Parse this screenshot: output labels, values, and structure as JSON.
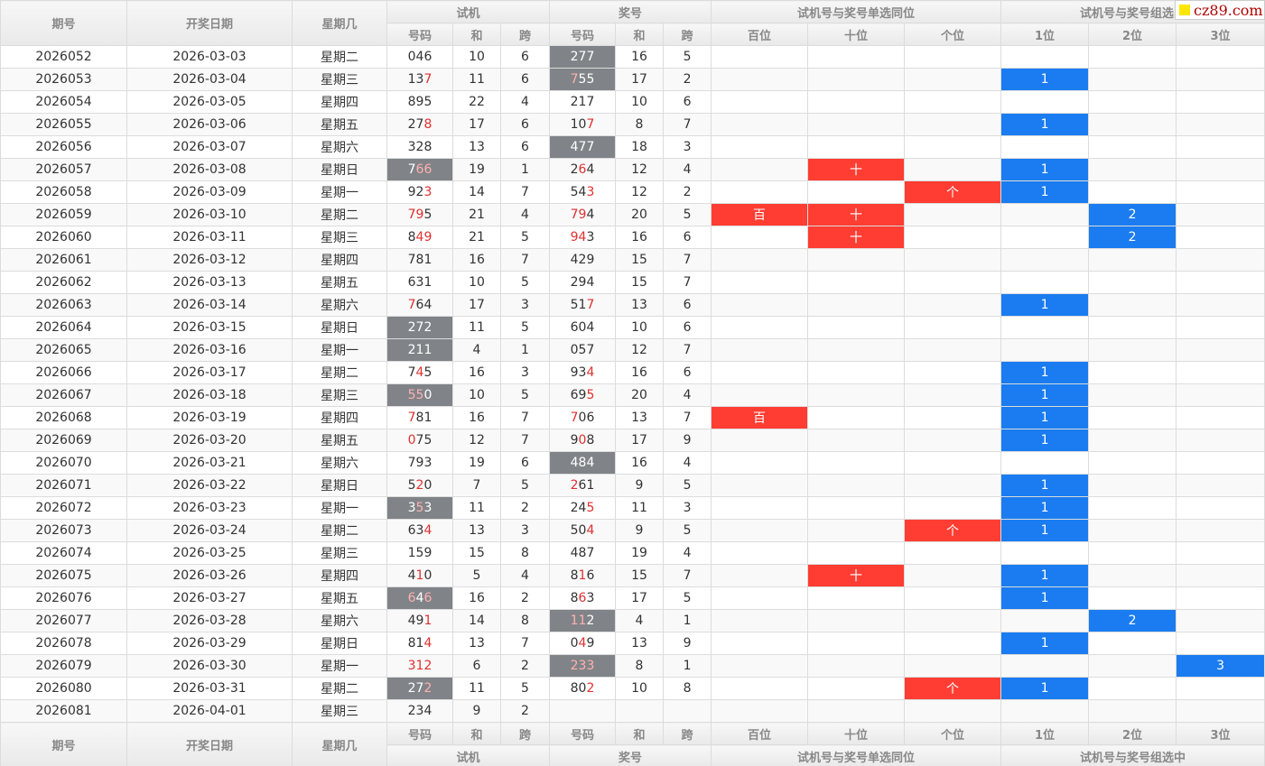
{
  "header": {
    "period": "期号",
    "date": "开奖日期",
    "weekday": "星期几",
    "test_group": "试机",
    "prize_group": "奖号",
    "single_group": "试机号与奖号单选同位",
    "combo_group": "试机号与奖号组选中",
    "num": "号码",
    "sum": "和",
    "span": "跨",
    "hundreds": "百位",
    "tens": "十位",
    "units": "个位",
    "pos1": "1位",
    "pos2": "2位",
    "pos3": "3位"
  },
  "watermark": "cz89.com",
  "colors": {
    "red_cell": "#ff3d33",
    "blue_cell": "#1a7cf0",
    "gray_cell": "#808488",
    "red_digit": "#e03030"
  },
  "rows": [
    {
      "period": "2026052",
      "date": "2026-03-03",
      "weekday": "星期二",
      "test": "046",
      "test_sum": "10",
      "test_span": "6",
      "prize": "277",
      "prize_sum": "16",
      "prize_span": "5",
      "test_gray": false,
      "prize_gray": true,
      "test_red": [],
      "prize_red": [],
      "bai": "",
      "shi": "",
      "ge": "",
      "c1": "",
      "c2": "",
      "c3": ""
    },
    {
      "period": "2026053",
      "date": "2026-03-04",
      "weekday": "星期三",
      "test": "137",
      "test_sum": "11",
      "test_span": "6",
      "prize": "755",
      "prize_sum": "17",
      "prize_span": "2",
      "test_gray": false,
      "prize_gray": true,
      "test_red": [
        2
      ],
      "prize_red": [
        0
      ],
      "bai": "",
      "shi": "",
      "ge": "",
      "c1": "1",
      "c2": "",
      "c3": ""
    },
    {
      "period": "2026054",
      "date": "2026-03-05",
      "weekday": "星期四",
      "test": "895",
      "test_sum": "22",
      "test_span": "4",
      "prize": "217",
      "prize_sum": "10",
      "prize_span": "6",
      "test_gray": false,
      "prize_gray": false,
      "test_red": [],
      "prize_red": [],
      "bai": "",
      "shi": "",
      "ge": "",
      "c1": "",
      "c2": "",
      "c3": ""
    },
    {
      "period": "2026055",
      "date": "2026-03-06",
      "weekday": "星期五",
      "test": "278",
      "test_sum": "17",
      "test_span": "6",
      "prize": "107",
      "prize_sum": "8",
      "prize_span": "7",
      "test_gray": false,
      "prize_gray": false,
      "test_red": [
        2
      ],
      "prize_red": [
        2
      ],
      "bai": "",
      "shi": "",
      "ge": "",
      "c1": "1",
      "c2": "",
      "c3": ""
    },
    {
      "period": "2026056",
      "date": "2026-03-07",
      "weekday": "星期六",
      "test": "328",
      "test_sum": "13",
      "test_span": "6",
      "prize": "477",
      "prize_sum": "18",
      "prize_span": "3",
      "test_gray": false,
      "prize_gray": true,
      "test_red": [],
      "prize_red": [],
      "bai": "",
      "shi": "",
      "ge": "",
      "c1": "",
      "c2": "",
      "c3": ""
    },
    {
      "period": "2026057",
      "date": "2026-03-08",
      "weekday": "星期日",
      "test": "766",
      "test_sum": "19",
      "test_span": "1",
      "prize": "264",
      "prize_sum": "12",
      "prize_span": "4",
      "test_gray": true,
      "prize_gray": false,
      "test_red": [
        1,
        2
      ],
      "prize_red": [
        1
      ],
      "bai": "",
      "shi": "十",
      "ge": "",
      "c1": "1",
      "c2": "",
      "c3": ""
    },
    {
      "period": "2026058",
      "date": "2026-03-09",
      "weekday": "星期一",
      "test": "923",
      "test_sum": "14",
      "test_span": "7",
      "prize": "543",
      "prize_sum": "12",
      "prize_span": "2",
      "test_gray": false,
      "prize_gray": false,
      "test_red": [
        2
      ],
      "prize_red": [
        2
      ],
      "bai": "",
      "shi": "",
      "ge": "个",
      "c1": "1",
      "c2": "",
      "c3": ""
    },
    {
      "period": "2026059",
      "date": "2026-03-10",
      "weekday": "星期二",
      "test": "795",
      "test_sum": "21",
      "test_span": "4",
      "prize": "794",
      "prize_sum": "20",
      "prize_span": "5",
      "test_gray": false,
      "prize_gray": false,
      "test_red": [
        0,
        1
      ],
      "prize_red": [
        0,
        1
      ],
      "bai": "百",
      "shi": "十",
      "ge": "",
      "c1": "",
      "c2": "2",
      "c3": ""
    },
    {
      "period": "2026060",
      "date": "2026-03-11",
      "weekday": "星期三",
      "test": "849",
      "test_sum": "21",
      "test_span": "5",
      "prize": "943",
      "prize_sum": "16",
      "prize_span": "6",
      "test_gray": false,
      "prize_gray": false,
      "test_red": [
        1,
        2
      ],
      "prize_red": [
        0,
        1
      ],
      "bai": "",
      "shi": "十",
      "ge": "",
      "c1": "",
      "c2": "2",
      "c3": ""
    },
    {
      "period": "2026061",
      "date": "2026-03-12",
      "weekday": "星期四",
      "test": "781",
      "test_sum": "16",
      "test_span": "7",
      "prize": "429",
      "prize_sum": "15",
      "prize_span": "7",
      "test_gray": false,
      "prize_gray": false,
      "test_red": [],
      "prize_red": [],
      "bai": "",
      "shi": "",
      "ge": "",
      "c1": "",
      "c2": "",
      "c3": ""
    },
    {
      "period": "2026062",
      "date": "2026-03-13",
      "weekday": "星期五",
      "test": "631",
      "test_sum": "10",
      "test_span": "5",
      "prize": "294",
      "prize_sum": "15",
      "prize_span": "7",
      "test_gray": false,
      "prize_gray": false,
      "test_red": [],
      "prize_red": [],
      "bai": "",
      "shi": "",
      "ge": "",
      "c1": "",
      "c2": "",
      "c3": ""
    },
    {
      "period": "2026063",
      "date": "2026-03-14",
      "weekday": "星期六",
      "test": "764",
      "test_sum": "17",
      "test_span": "3",
      "prize": "517",
      "prize_sum": "13",
      "prize_span": "6",
      "test_gray": false,
      "prize_gray": false,
      "test_red": [
        0
      ],
      "prize_red": [
        2
      ],
      "bai": "",
      "shi": "",
      "ge": "",
      "c1": "1",
      "c2": "",
      "c3": ""
    },
    {
      "period": "2026064",
      "date": "2026-03-15",
      "weekday": "星期日",
      "test": "272",
      "test_sum": "11",
      "test_span": "5",
      "prize": "604",
      "prize_sum": "10",
      "prize_span": "6",
      "test_gray": true,
      "prize_gray": false,
      "test_red": [],
      "prize_red": [],
      "bai": "",
      "shi": "",
      "ge": "",
      "c1": "",
      "c2": "",
      "c3": ""
    },
    {
      "period": "2026065",
      "date": "2026-03-16",
      "weekday": "星期一",
      "test": "211",
      "test_sum": "4",
      "test_span": "1",
      "prize": "057",
      "prize_sum": "12",
      "prize_span": "7",
      "test_gray": true,
      "prize_gray": false,
      "test_red": [],
      "prize_red": [],
      "bai": "",
      "shi": "",
      "ge": "",
      "c1": "",
      "c2": "",
      "c3": ""
    },
    {
      "period": "2026066",
      "date": "2026-03-17",
      "weekday": "星期二",
      "test": "745",
      "test_sum": "16",
      "test_span": "3",
      "prize": "934",
      "prize_sum": "16",
      "prize_span": "6",
      "test_gray": false,
      "prize_gray": false,
      "test_red": [
        1
      ],
      "prize_red": [
        2
      ],
      "bai": "",
      "shi": "",
      "ge": "",
      "c1": "1",
      "c2": "",
      "c3": ""
    },
    {
      "period": "2026067",
      "date": "2026-03-18",
      "weekday": "星期三",
      "test": "550",
      "test_sum": "10",
      "test_span": "5",
      "prize": "695",
      "prize_sum": "20",
      "prize_span": "4",
      "test_gray": true,
      "prize_gray": false,
      "test_red": [
        0,
        1
      ],
      "prize_red": [
        2
      ],
      "bai": "",
      "shi": "",
      "ge": "",
      "c1": "1",
      "c2": "",
      "c3": ""
    },
    {
      "period": "2026068",
      "date": "2026-03-19",
      "weekday": "星期四",
      "test": "781",
      "test_sum": "16",
      "test_span": "7",
      "prize": "706",
      "prize_sum": "13",
      "prize_span": "7",
      "test_gray": false,
      "prize_gray": false,
      "test_red": [
        0
      ],
      "prize_red": [
        0
      ],
      "bai": "百",
      "shi": "",
      "ge": "",
      "c1": "1",
      "c2": "",
      "c3": ""
    },
    {
      "period": "2026069",
      "date": "2026-03-20",
      "weekday": "星期五",
      "test": "075",
      "test_sum": "12",
      "test_span": "7",
      "prize": "908",
      "prize_sum": "17",
      "prize_span": "9",
      "test_gray": false,
      "prize_gray": false,
      "test_red": [
        0
      ],
      "prize_red": [
        1
      ],
      "bai": "",
      "shi": "",
      "ge": "",
      "c1": "1",
      "c2": "",
      "c3": ""
    },
    {
      "period": "2026070",
      "date": "2026-03-21",
      "weekday": "星期六",
      "test": "793",
      "test_sum": "19",
      "test_span": "6",
      "prize": "484",
      "prize_sum": "16",
      "prize_span": "4",
      "test_gray": false,
      "prize_gray": true,
      "test_red": [],
      "prize_red": [],
      "bai": "",
      "shi": "",
      "ge": "",
      "c1": "",
      "c2": "",
      "c3": ""
    },
    {
      "period": "2026071",
      "date": "2026-03-22",
      "weekday": "星期日",
      "test": "520",
      "test_sum": "7",
      "test_span": "5",
      "prize": "261",
      "prize_sum": "9",
      "prize_span": "5",
      "test_gray": false,
      "prize_gray": false,
      "test_red": [
        1
      ],
      "prize_red": [
        0
      ],
      "bai": "",
      "shi": "",
      "ge": "",
      "c1": "1",
      "c2": "",
      "c3": ""
    },
    {
      "period": "2026072",
      "date": "2026-03-23",
      "weekday": "星期一",
      "test": "353",
      "test_sum": "11",
      "test_span": "2",
      "prize": "245",
      "prize_sum": "11",
      "prize_span": "3",
      "test_gray": true,
      "prize_gray": false,
      "test_red": [
        1
      ],
      "prize_red": [
        2
      ],
      "bai": "",
      "shi": "",
      "ge": "",
      "c1": "1",
      "c2": "",
      "c3": ""
    },
    {
      "period": "2026073",
      "date": "2026-03-24",
      "weekday": "星期二",
      "test": "634",
      "test_sum": "13",
      "test_span": "3",
      "prize": "504",
      "prize_sum": "9",
      "prize_span": "5",
      "test_gray": false,
      "prize_gray": false,
      "test_red": [
        2
      ],
      "prize_red": [
        2
      ],
      "bai": "",
      "shi": "",
      "ge": "个",
      "c1": "1",
      "c2": "",
      "c3": ""
    },
    {
      "period": "2026074",
      "date": "2026-03-25",
      "weekday": "星期三",
      "test": "159",
      "test_sum": "15",
      "test_span": "8",
      "prize": "487",
      "prize_sum": "19",
      "prize_span": "4",
      "test_gray": false,
      "prize_gray": false,
      "test_red": [],
      "prize_red": [],
      "bai": "",
      "shi": "",
      "ge": "",
      "c1": "",
      "c2": "",
      "c3": ""
    },
    {
      "period": "2026075",
      "date": "2026-03-26",
      "weekday": "星期四",
      "test": "410",
      "test_sum": "5",
      "test_span": "4",
      "prize": "816",
      "prize_sum": "15",
      "prize_span": "7",
      "test_gray": false,
      "prize_gray": false,
      "test_red": [
        1
      ],
      "prize_red": [
        1
      ],
      "bai": "",
      "shi": "十",
      "ge": "",
      "c1": "1",
      "c2": "",
      "c3": ""
    },
    {
      "period": "2026076",
      "date": "2026-03-27",
      "weekday": "星期五",
      "test": "646",
      "test_sum": "16",
      "test_span": "2",
      "prize": "863",
      "prize_sum": "17",
      "prize_span": "5",
      "test_gray": true,
      "prize_gray": false,
      "test_red": [
        0,
        2
      ],
      "prize_red": [
        1
      ],
      "bai": "",
      "shi": "",
      "ge": "",
      "c1": "1",
      "c2": "",
      "c3": ""
    },
    {
      "period": "2026077",
      "date": "2026-03-28",
      "weekday": "星期六",
      "test": "491",
      "test_sum": "14",
      "test_span": "8",
      "prize": "112",
      "prize_sum": "4",
      "prize_span": "1",
      "test_gray": false,
      "prize_gray": true,
      "test_red": [
        2
      ],
      "prize_red": [
        0,
        1
      ],
      "bai": "",
      "shi": "",
      "ge": "",
      "c1": "",
      "c2": "2",
      "c3": ""
    },
    {
      "period": "2026078",
      "date": "2026-03-29",
      "weekday": "星期日",
      "test": "814",
      "test_sum": "13",
      "test_span": "7",
      "prize": "049",
      "prize_sum": "13",
      "prize_span": "9",
      "test_gray": false,
      "prize_gray": false,
      "test_red": [
        2
      ],
      "prize_red": [
        1
      ],
      "bai": "",
      "shi": "",
      "ge": "",
      "c1": "1",
      "c2": "",
      "c3": ""
    },
    {
      "period": "2026079",
      "date": "2026-03-30",
      "weekday": "星期一",
      "test": "312",
      "test_sum": "6",
      "test_span": "2",
      "prize": "233",
      "prize_sum": "8",
      "prize_span": "1",
      "test_gray": false,
      "prize_gray": true,
      "test_red": [
        0,
        1,
        2
      ],
      "prize_red": [
        0,
        1,
        2
      ],
      "bai": "",
      "shi": "",
      "ge": "",
      "c1": "",
      "c2": "",
      "c3": "3"
    },
    {
      "period": "2026080",
      "date": "2026-03-31",
      "weekday": "星期二",
      "test": "272",
      "test_sum": "11",
      "test_span": "5",
      "prize": "802",
      "prize_sum": "10",
      "prize_span": "8",
      "test_gray": true,
      "prize_gray": false,
      "test_red": [
        2
      ],
      "prize_red": [
        2
      ],
      "bai": "",
      "shi": "",
      "ge": "个",
      "c1": "1",
      "c2": "",
      "c3": ""
    },
    {
      "period": "2026081",
      "date": "2026-04-01",
      "weekday": "星期三",
      "test": "234",
      "test_sum": "9",
      "test_span": "2",
      "prize": "",
      "prize_sum": "",
      "prize_span": "",
      "test_gray": false,
      "prize_gray": false,
      "test_red": [],
      "prize_red": [],
      "bai": "",
      "shi": "",
      "ge": "",
      "c1": "",
      "c2": "",
      "c3": ""
    }
  ]
}
